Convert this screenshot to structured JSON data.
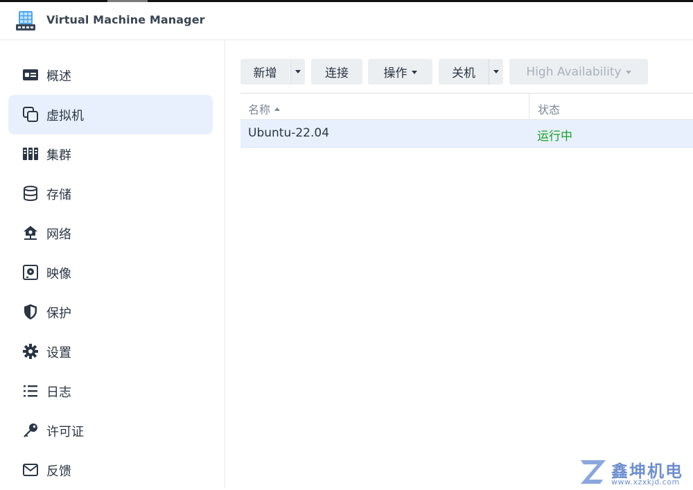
{
  "app": {
    "title": "Virtual Machine Manager"
  },
  "sidebar": {
    "items": [
      {
        "label": "概述",
        "icon": "overview-icon",
        "active": false
      },
      {
        "label": "虚拟机",
        "icon": "virtual-machine-icon",
        "active": true
      },
      {
        "label": "集群",
        "icon": "cluster-icon",
        "active": false
      },
      {
        "label": "存储",
        "icon": "storage-icon",
        "active": false
      },
      {
        "label": "网络",
        "icon": "network-icon",
        "active": false
      },
      {
        "label": "映像",
        "icon": "image-icon",
        "active": false
      },
      {
        "label": "保护",
        "icon": "shield-icon",
        "active": false
      },
      {
        "label": "设置",
        "icon": "gear-icon",
        "active": false
      },
      {
        "label": "日志",
        "icon": "log-list-icon",
        "active": false
      },
      {
        "label": "许可证",
        "icon": "key-icon",
        "active": false
      },
      {
        "label": "反馈",
        "icon": "mail-icon",
        "active": false
      }
    ]
  },
  "toolbar": {
    "create_label": "新增",
    "connect_label": "连接",
    "action_label": "操作",
    "shutdown_label": "关机",
    "ha_label": "High Availability"
  },
  "table": {
    "columns": [
      "名称",
      "状态"
    ],
    "rows": [
      {
        "name": "Ubuntu-22.04",
        "status": "运行中"
      }
    ]
  },
  "watermark": {
    "text": "鑫坤机电",
    "url": "www.xzxkjd.com"
  },
  "colors": {
    "accent": "#e8f0fd",
    "status_running": "#1aa024",
    "watermark": "#6e8fd0"
  }
}
